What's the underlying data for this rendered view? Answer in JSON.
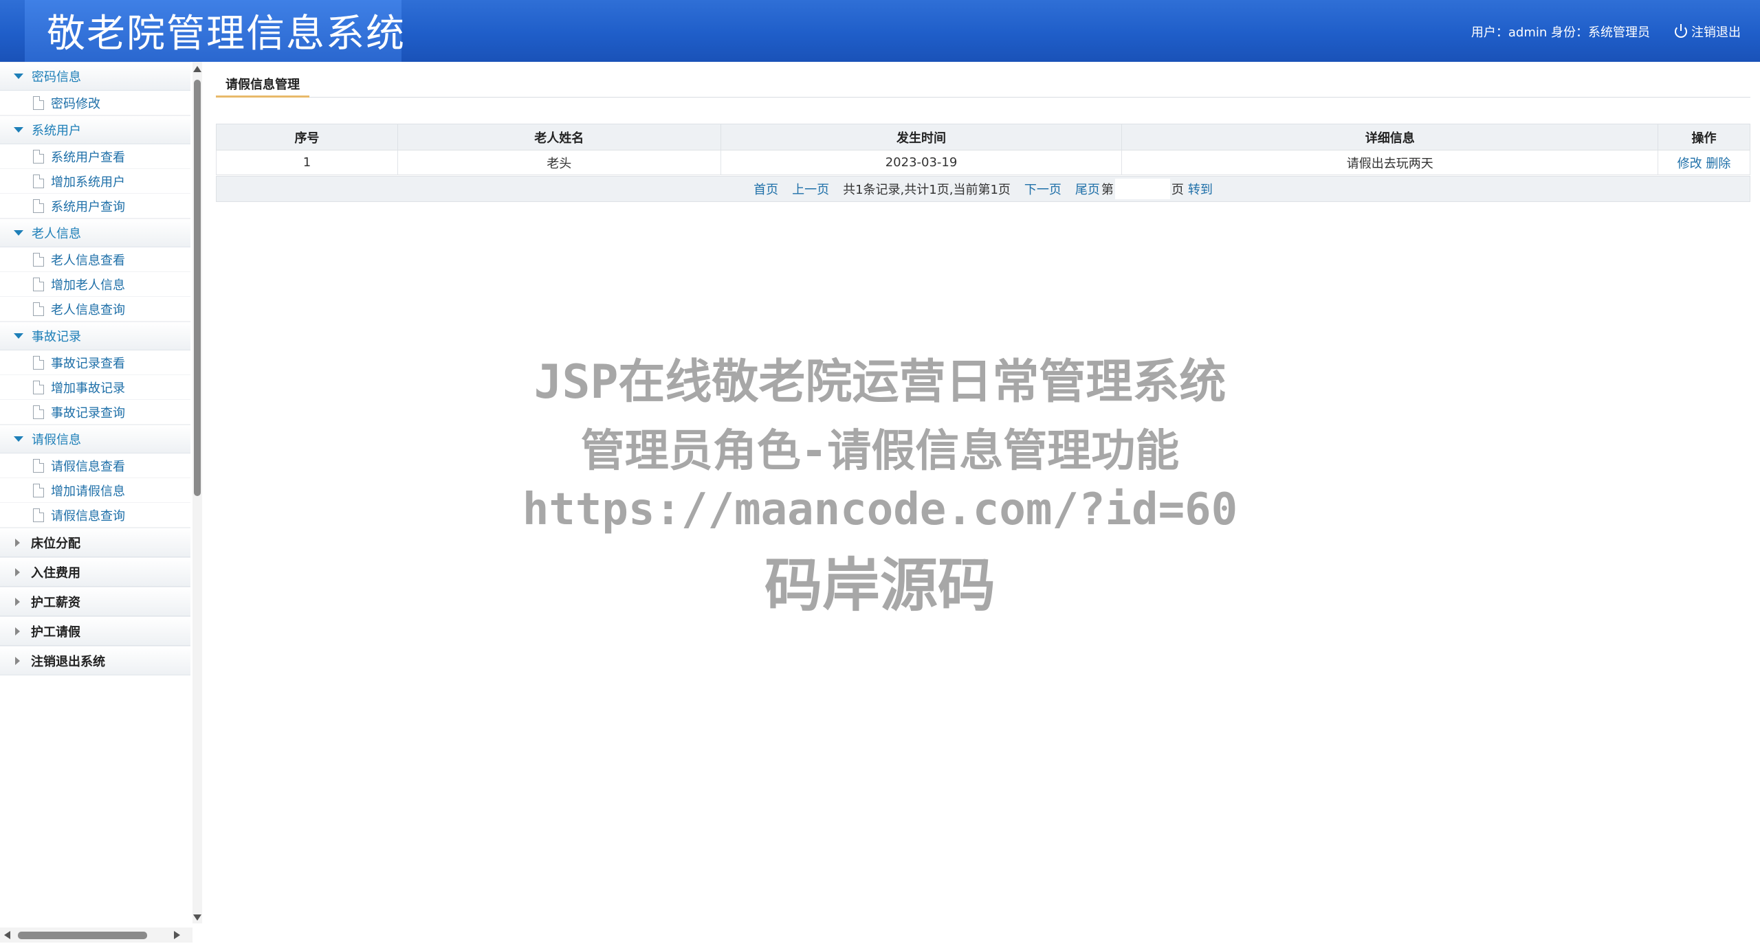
{
  "header": {
    "title": "敬老院管理信息系统",
    "user_label": "用户：admin 身份：系统管理员",
    "logout": "注销退出"
  },
  "sidebar": {
    "groups": [
      {
        "label": "密码信息",
        "open": true,
        "items": [
          "密码修改"
        ]
      },
      {
        "label": "系统用户",
        "open": true,
        "items": [
          "系统用户查看",
          "增加系统用户",
          "系统用户查询"
        ]
      },
      {
        "label": "老人信息",
        "open": true,
        "items": [
          "老人信息查看",
          "增加老人信息",
          "老人信息查询"
        ]
      },
      {
        "label": "事故记录",
        "open": true,
        "items": [
          "事故记录查看",
          "增加事故记录",
          "事故记录查询"
        ]
      },
      {
        "label": "请假信息",
        "open": true,
        "items": [
          "请假信息查看",
          "增加请假信息",
          "请假信息查询"
        ]
      },
      {
        "label": "床位分配",
        "open": false,
        "items": []
      },
      {
        "label": "入住费用",
        "open": false,
        "items": []
      },
      {
        "label": "护工薪资",
        "open": false,
        "items": []
      },
      {
        "label": "护工请假",
        "open": false,
        "items": []
      },
      {
        "label": "注销退出系统",
        "open": false,
        "items": []
      }
    ]
  },
  "main": {
    "tab": "请假信息管理",
    "table": {
      "columns": [
        "序号",
        "老人姓名",
        "发生时间",
        "详细信息",
        "操作"
      ],
      "rows": [
        {
          "seq": "1",
          "name": "老头",
          "time": "2023-03-19",
          "detail": "请假出去玩两天",
          "edit": "修改",
          "delete": "删除"
        }
      ]
    },
    "pager": {
      "first": "首页",
      "prev": "上一页",
      "info": "共1条记录,共计1页,当前第1页",
      "next": "下一页",
      "last": "尾页",
      "goto_prefix": "第",
      "goto_suffix": "页",
      "goto": "转到"
    }
  },
  "watermark": {
    "line1": "JSP在线敬老院运营日常管理系统",
    "line2": "管理员角色-请假信息管理功能",
    "line3": "https://maancode.com/?id=60",
    "line4": "码岸源码"
  }
}
